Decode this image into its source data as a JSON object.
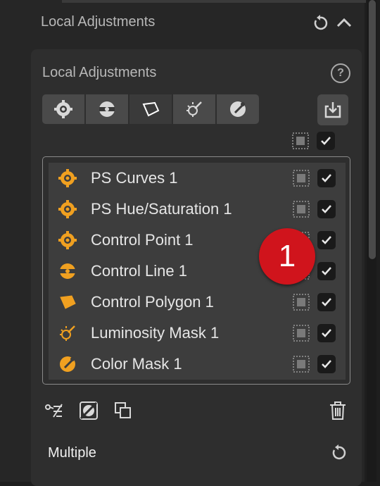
{
  "section": {
    "title": "Local Adjustments"
  },
  "panel": {
    "title": "Local Adjustments",
    "help_label": "?"
  },
  "toolbar": {
    "tools": [
      {
        "name": "control-point-tool"
      },
      {
        "name": "control-line-tool"
      },
      {
        "name": "control-polygon-tool"
      },
      {
        "name": "luminosity-mask-tool"
      },
      {
        "name": "color-mask-tool"
      }
    ]
  },
  "layers": [
    {
      "label": "PS Curves 1",
      "icon": "control-point-icon"
    },
    {
      "label": "PS Hue/Saturation 1",
      "icon": "control-point-icon"
    },
    {
      "label": "Control Point 1",
      "icon": "control-point-icon"
    },
    {
      "label": "Control Line 1",
      "icon": "control-line-icon"
    },
    {
      "label": "Control Polygon 1",
      "icon": "control-polygon-icon"
    },
    {
      "label": "Luminosity Mask 1",
      "icon": "luminosity-mask-icon"
    },
    {
      "label": "Color Mask 1",
      "icon": "color-mask-icon"
    }
  ],
  "annotation": {
    "badge": "1"
  },
  "footer": {
    "selection_label": "Multiple"
  },
  "colors": {
    "accent": "#f0a020",
    "badge": "#d0141c"
  }
}
